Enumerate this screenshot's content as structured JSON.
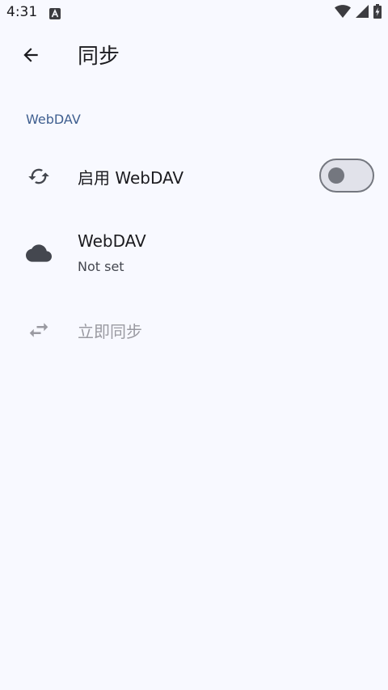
{
  "status_bar": {
    "time": "4:31",
    "notification_icon": "a-letter-icon",
    "icons": [
      "wifi-icon",
      "cellular-signal-icon",
      "battery-charging-icon"
    ]
  },
  "app_bar": {
    "back_icon": "arrow-back-icon",
    "title": "同步"
  },
  "section": {
    "header": "WebDAV"
  },
  "rows": {
    "enable": {
      "icon": "sync-icon",
      "title": "启用 WebDAV",
      "toggle_on": false
    },
    "server": {
      "icon": "cloud-icon",
      "title": "WebDAV",
      "summary": "Not set"
    },
    "sync_now": {
      "icon": "swap-horiz-icon",
      "title": "立即同步",
      "enabled": false
    }
  },
  "colors": {
    "background": "#f8f9ff",
    "section_header": "#3f5f90",
    "text_primary": "#1b1b1f",
    "text_secondary": "#44474f",
    "text_disabled": "#9a9aa1",
    "toggle_outline": "#74777f"
  }
}
